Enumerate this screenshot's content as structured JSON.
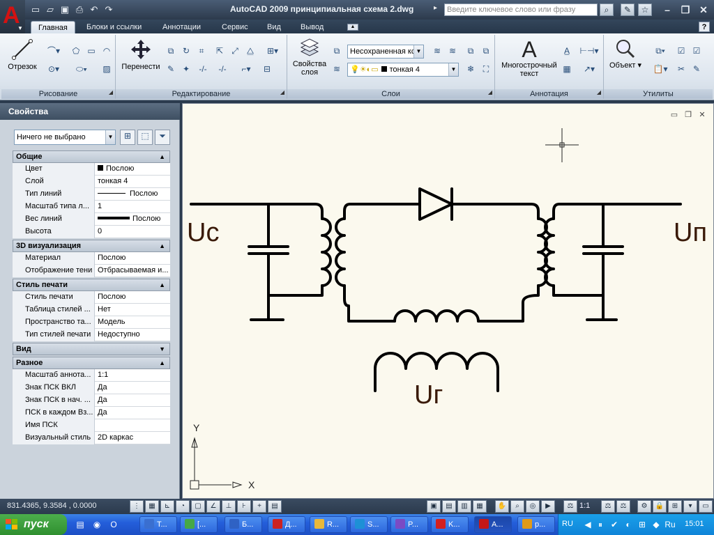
{
  "app": {
    "title": "AutoCAD 2009 принципиальная схема 2.dwg",
    "logo_letter": "A",
    "search_placeholder": "Введите ключевое слово или фразу"
  },
  "ribbon_tabs": [
    "Главная",
    "Блоки и ссылки",
    "Аннотации",
    "Сервис",
    "Вид",
    "Вывод"
  ],
  "ribbon": {
    "draw": {
      "title": "Рисование",
      "line_label": "Отрезок"
    },
    "modify": {
      "title": "Редактирование",
      "move_label": "Перенести"
    },
    "layers": {
      "title": "Слои",
      "props_label_1": "Свойства",
      "props_label_2": "слоя",
      "layer_state": "Несохраненная кс",
      "current_layer": "тонкая 4"
    },
    "annotation": {
      "title": "Аннотация",
      "mtext_label_1": "Многострочный",
      "mtext_label_2": "текст"
    },
    "utilities": {
      "title": "Утилиты",
      "object_label": "Объект"
    }
  },
  "properties": {
    "title": "Свойства",
    "selection": "Ничего не выбрано",
    "categories": [
      {
        "name": "Общие",
        "rows": [
          {
            "key": "Цвет",
            "value": "Послою",
            "kind": "color"
          },
          {
            "key": "Слой",
            "value": "тонкая 4"
          },
          {
            "key": "Тип линий",
            "value": "Послою",
            "kind": "linetype"
          },
          {
            "key": "Масштаб типа л...",
            "value": "1"
          },
          {
            "key": "Вес линий",
            "value": "Послою",
            "kind": "lineweight"
          },
          {
            "key": "Высота",
            "value": "0"
          }
        ]
      },
      {
        "name": "3D визуализация",
        "rows": [
          {
            "key": "Материал",
            "value": "Послою"
          },
          {
            "key": "Отображение тени",
            "value": "Отбрасываемая и..."
          }
        ]
      },
      {
        "name": "Стиль печати",
        "rows": [
          {
            "key": "Стиль печати",
            "value": "Послою"
          },
          {
            "key": "Таблица стилей ...",
            "value": "Нет"
          },
          {
            "key": "Пространство та...",
            "value": "Модель"
          },
          {
            "key": "Тип стилей печати",
            "value": "Недоступно"
          }
        ]
      },
      {
        "name": "Вид",
        "rows": [],
        "collapsed": true
      },
      {
        "name": "Разное",
        "rows": [
          {
            "key": "Масштаб аннота...",
            "value": "1:1"
          },
          {
            "key": "Знак ПСК ВКЛ",
            "value": "Да"
          },
          {
            "key": "Знак ПСК в нач. ...",
            "value": "Да"
          },
          {
            "key": "ПСК в каждом Вз...",
            "value": "Да"
          },
          {
            "key": "Имя ПСК",
            "value": ""
          },
          {
            "key": "Визуальный стиль",
            "value": "2D каркас"
          }
        ]
      }
    ]
  },
  "drawing": {
    "label_input": "Uc",
    "label_output": "Uп",
    "label_generator": "Uг",
    "ucs_x": "X",
    "ucs_y": "Y",
    "line_color": "#000000",
    "label_color": "#3a1a08",
    "background": "#fbf9ee"
  },
  "status": {
    "coords": "831.4365, 9.3584 , 0.0000",
    "annotation_scale": "1:1"
  },
  "taskbar": {
    "start_label": "пуск",
    "tasks": [
      {
        "label": "T...",
        "color": "#3a6fd0"
      },
      {
        "label": "[...",
        "color": "#46a846"
      },
      {
        "label": "Б...",
        "color": "#2f62c4"
      },
      {
        "label": "Д...",
        "color": "#cc2222"
      },
      {
        "label": "R...",
        "color": "#e8b83a"
      },
      {
        "label": "S...",
        "color": "#1e90d6"
      },
      {
        "label": "P...",
        "color": "#7a4bc4"
      },
      {
        "label": "K...",
        "color": "#d42020"
      },
      {
        "label": "A...",
        "color": "#c51818",
        "active": true
      },
      {
        "label": "p...",
        "color": "#e09a18"
      }
    ],
    "language": "RU",
    "clock": "15:01"
  }
}
